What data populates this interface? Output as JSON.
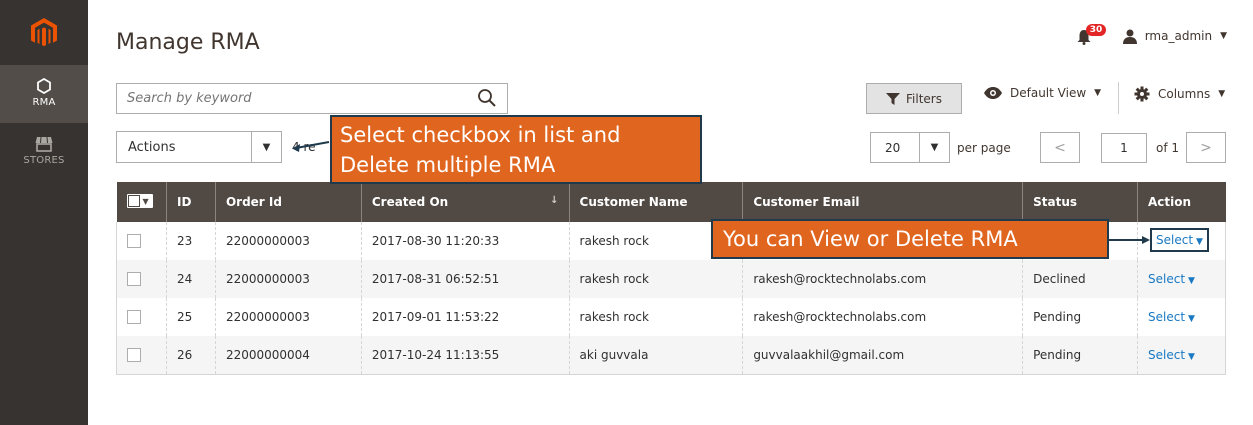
{
  "sidebar": {
    "logo": "magento-logo",
    "items": [
      {
        "label": "RMA",
        "icon": "hexagon-icon",
        "active": true
      },
      {
        "label": "STORES",
        "icon": "store-icon",
        "active": false
      }
    ]
  },
  "header": {
    "title": "Manage RMA",
    "notifications_count": "30",
    "user": "rma_admin"
  },
  "toolbar": {
    "search_placeholder": "Search by keyword",
    "filters_label": "Filters",
    "view_label": "Default View",
    "columns_label": "Columns",
    "actions_label": "Actions",
    "records_text": "4 re",
    "per_page_value": "20",
    "per_page_label": "per page",
    "current_page": "1",
    "page_total": "of 1"
  },
  "table": {
    "headers": [
      "ID",
      "Order Id",
      "Created On",
      "Customer Name",
      "Customer Email",
      "Status",
      "Action"
    ],
    "rows": [
      {
        "id": "23",
        "order_id": "22000000003",
        "created_on": "2017-08-30 11:20:33",
        "customer_name": "rakesh rock",
        "customer_email": "",
        "status": "",
        "action": "Select"
      },
      {
        "id": "24",
        "order_id": "22000000003",
        "created_on": "2017-08-31 06:52:51",
        "customer_name": "rakesh rock",
        "customer_email": "rakesh@rocktechnolabs.com",
        "status": "Declined",
        "action": "Select"
      },
      {
        "id": "25",
        "order_id": "22000000003",
        "created_on": "2017-09-01 11:53:22",
        "customer_name": "rakesh rock",
        "customer_email": "rakesh@rocktechnolabs.com",
        "status": "Pending",
        "action": "Select"
      },
      {
        "id": "26",
        "order_id": "22000000004",
        "created_on": "2017-10-24 11:13:55",
        "customer_name": "aki guvvala",
        "customer_email": "guvvalaakhil@gmail.com",
        "status": "Pending",
        "action": "Select"
      }
    ]
  },
  "callouts": {
    "mass_delete_line1": "Select checkbox in list and",
    "mass_delete_line2": "Delete multiple RMA",
    "row_action": "You can View or Delete RMA"
  },
  "colors": {
    "sidebar_bg": "#373330",
    "header_row_bg": "#514943",
    "callout_bg": "#e0651f",
    "link": "#1979c3",
    "badge": "#e22626"
  }
}
